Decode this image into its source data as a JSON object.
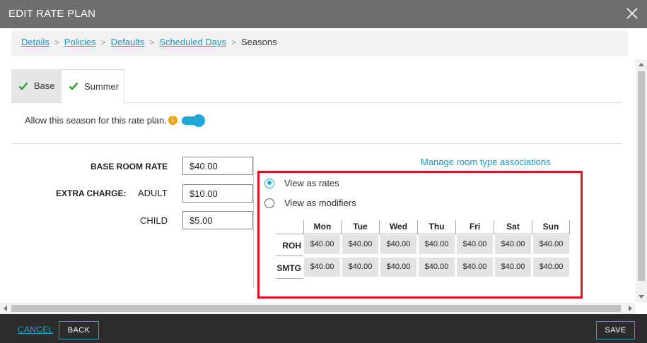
{
  "window": {
    "title": "EDIT RATE PLAN",
    "close_icon": "close-icon"
  },
  "breadcrumb": {
    "links": [
      "Details",
      "Policies",
      "Defaults",
      "Scheduled Days"
    ],
    "separator": ">",
    "current": "Seasons"
  },
  "tabs": [
    {
      "label": "Base",
      "checked": true,
      "active": false
    },
    {
      "label": "Summer",
      "checked": true,
      "active": true
    }
  ],
  "allow_season": {
    "label": "Allow this season for this rate plan.",
    "info": "i",
    "enabled": true
  },
  "form": {
    "base_room_rate_label": "BASE ROOM RATE",
    "base_room_rate_value": "$40.00",
    "extra_charge_label": "EXTRA CHARGE:",
    "adult_label": "ADULT",
    "adult_value": "$10.00",
    "child_label": "CHILD",
    "child_value": "$5.00"
  },
  "manage_link": "Manage room type associations",
  "view_options": {
    "rates_label": "View as rates",
    "modifiers_label": "View as modifiers",
    "selected": "rates"
  },
  "rate_grid": {
    "days": [
      "Mon",
      "Tue",
      "Wed",
      "Thu",
      "Fri",
      "Sat",
      "Sun"
    ],
    "rows": [
      {
        "room": "ROH",
        "rates": [
          "$40.00",
          "$40.00",
          "$40.00",
          "$40.00",
          "$40.00",
          "$40.00",
          "$40.00"
        ]
      },
      {
        "room": "SMTG",
        "rates": [
          "$40.00",
          "$40.00",
          "$40.00",
          "$40.00",
          "$40.00",
          "$40.00",
          "$40.00"
        ]
      }
    ]
  },
  "footer": {
    "cancel_label": "CANCEL",
    "back_label": "BACK",
    "save_label": "SAVE"
  },
  "colors": {
    "accent": "#1ea8d8",
    "link": "#1c96c5",
    "highlight": "#e0121a",
    "check": "#2e9b2e",
    "info": "#f0a500"
  }
}
